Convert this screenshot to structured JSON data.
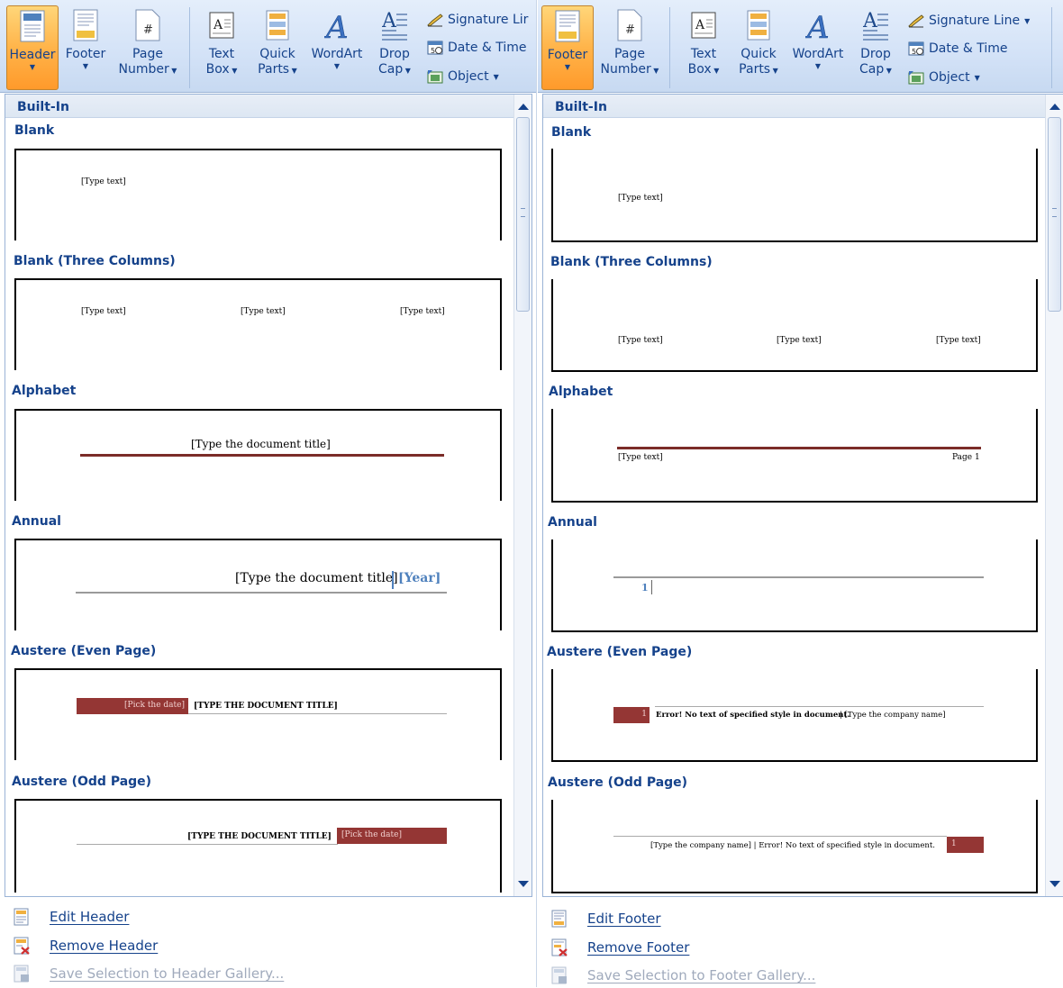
{
  "left": {
    "ribbon": {
      "header": "Header",
      "footer": "Footer",
      "page_number_1": "Page",
      "page_number_2": "Number",
      "text_box_1": "Text",
      "text_box_2": "Box",
      "quick_parts_1": "Quick",
      "quick_parts_2": "Parts",
      "wordart": "WordArt",
      "drop_cap_1": "Drop",
      "drop_cap_2": "Cap",
      "signature_line": "Signature Lir",
      "date_time": "Date & Time",
      "object": "Object"
    },
    "gallery_heading": "Built-In",
    "sections": [
      {
        "title": "Blank",
        "texts": [
          "[Type text]"
        ]
      },
      {
        "title": "Blank (Three Columns)",
        "texts": [
          "[Type text]",
          "[Type text]",
          "[Type text]"
        ]
      },
      {
        "title": "Alphabet",
        "texts": [
          "[Type the document title]"
        ]
      },
      {
        "title": "Annual",
        "texts": [
          "[Type the document title]",
          "[Year]"
        ]
      },
      {
        "title": "Austere (Even Page)",
        "texts": [
          "[Pick the date]",
          "[TYPE THE DOCUMENT TITLE]"
        ]
      },
      {
        "title": "Austere (Odd Page)",
        "texts": [
          "[TYPE THE DOCUMENT TITLE]",
          "[Pick the date]"
        ]
      }
    ],
    "menu": {
      "edit": "Edit Header",
      "remove": "Remove Header",
      "save": "Save Selection to Header Gallery..."
    }
  },
  "right": {
    "ribbon": {
      "footer": "Footer",
      "page_number_1": "Page",
      "page_number_2": "Number",
      "text_box_1": "Text",
      "text_box_2": "Box",
      "quick_parts_1": "Quick",
      "quick_parts_2": "Parts",
      "wordart": "WordArt",
      "drop_cap_1": "Drop",
      "drop_cap_2": "Cap",
      "signature_line": "Signature Line",
      "date_time": "Date & Time",
      "object": "Object"
    },
    "gallery_heading": "Built-In",
    "sections": [
      {
        "title": "Blank",
        "texts": [
          "[Type text]"
        ]
      },
      {
        "title": "Blank (Three Columns)",
        "texts": [
          "[Type text]",
          "[Type text]",
          "[Type text]"
        ]
      },
      {
        "title": "Alphabet",
        "texts": [
          "[Type text]",
          "Page 1"
        ]
      },
      {
        "title": "Annual",
        "texts": [
          "1"
        ]
      },
      {
        "title": "Austere (Even Page)",
        "texts": [
          "1",
          "Error! No text of specified style in document.",
          "| [Type the company name]"
        ]
      },
      {
        "title": "Austere (Odd Page)",
        "texts": [
          "[Type the company name] | Error! No text of specified style in document.",
          "1"
        ]
      }
    ],
    "menu": {
      "edit": "Edit Footer",
      "remove": "Remove Footer",
      "save": "Save Selection to Footer Gallery..."
    }
  },
  "colors": {
    "accent_dark_red": "#943634",
    "alphabet_rule": "#7b2c28",
    "ribbon_active": "#ffb44a",
    "text_blue": "#15428b",
    "year_blue": "#4f81bd"
  }
}
